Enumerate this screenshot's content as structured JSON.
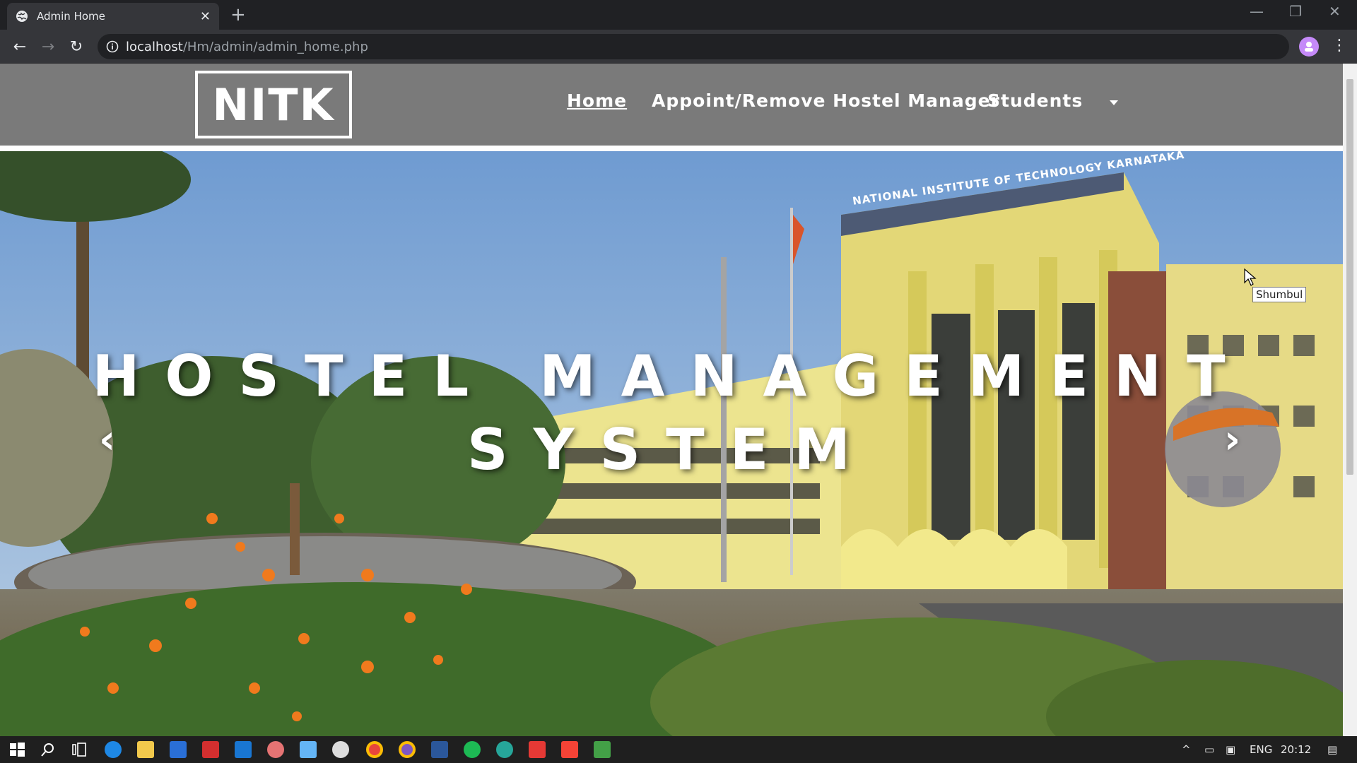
{
  "browser": {
    "tab_title": "Admin Home",
    "url_host": "localhost",
    "url_path": "/Hm/admin/admin_home.php"
  },
  "site": {
    "logo": "NITK",
    "nav": [
      {
        "label": "Home",
        "active": true
      },
      {
        "label": "Appoint/Remove Hostel Manager",
        "active": false
      },
      {
        "label": "Students",
        "active": false
      }
    ]
  },
  "hero": {
    "title_line1": "HOSTEL MANAGEMENT",
    "title_line2": "SYSTEM",
    "building_sign": "NATIONAL INSTITUTE OF TECHNOLOGY KARNATAKA",
    "tooltip": "Shumbul"
  },
  "taskbar": {
    "lang": "ENG",
    "time": "20:12"
  },
  "colors": {
    "header_bg": "#7a7a7a",
    "sky": "#7fa6d6",
    "building": "#e9e08a",
    "chrome_dark": "#202124"
  }
}
